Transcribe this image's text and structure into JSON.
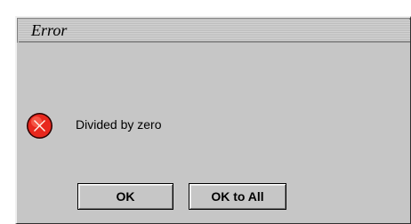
{
  "dialog": {
    "title": "Error",
    "message": "Divided by zero",
    "icon": "error-circle-x-icon",
    "buttons": {
      "ok_label": "OK",
      "ok_all_label": "OK to All"
    }
  },
  "colors": {
    "dialog_bg": "#c6c6c6",
    "icon_red": "#e8281e"
  }
}
